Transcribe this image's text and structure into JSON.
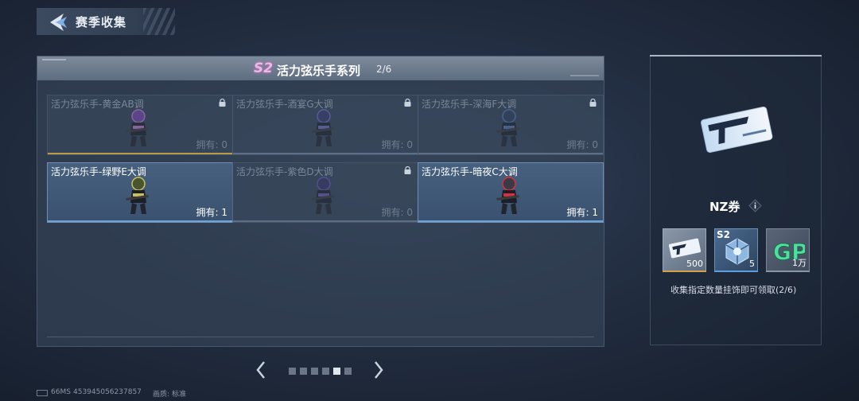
{
  "header": {
    "title": "赛季收集"
  },
  "panel": {
    "badge": "S2",
    "title": "活力弦乐手系列",
    "progress": "2/6",
    "cards": [
      {
        "name": "活力弦乐手-黄金AB调",
        "owned_text": "拥有: 0",
        "locked": true,
        "bar_color": "#b89a4a",
        "char_color": "#7a48b0",
        "accent": "#cc7fd8"
      },
      {
        "name": "活力弦乐手-酒宴G大调",
        "owned_text": "拥有: 0",
        "locked": true,
        "bar_color": "#5e6f85",
        "char_color": "#3d3a6e",
        "accent": "#6f74c8"
      },
      {
        "name": "活力弦乐手-深海F大调",
        "owned_text": "拥有: 0",
        "locked": true,
        "bar_color": "#5e6f85",
        "char_color": "#2d3d5e",
        "accent": "#5a7bb8"
      },
      {
        "name": "活力弦乐手-绿野E大调",
        "owned_text": "拥有: 1",
        "locked": false,
        "bar_color": "#6fa3d6",
        "char_color": "#4a5530",
        "accent": "#c8c060"
      },
      {
        "name": "活力弦乐手-紫色D大调",
        "owned_text": "拥有: 0",
        "locked": true,
        "bar_color": "#5e6f85",
        "char_color": "#3a3468",
        "accent": "#6a5ab8"
      },
      {
        "name": "活力弦乐手-暗夜C大调",
        "owned_text": "拥有: 1",
        "locked": false,
        "bar_color": "#6fa3d6",
        "char_color": "#3a3a44",
        "accent": "#d83040"
      }
    ]
  },
  "pagination": {
    "pages": 6,
    "current": 5
  },
  "reward": {
    "name": "NZ券",
    "items": [
      {
        "label": "",
        "count": "500",
        "icon": "nz-ticket-icon",
        "bar": "#d4a04a"
      },
      {
        "label": "S2",
        "count": "5",
        "icon": "s2-box-icon",
        "bar": "#5aa0e0"
      },
      {
        "label": "",
        "count": "1万",
        "icon": "gp-icon",
        "bar": "#8a96a6"
      }
    ],
    "description": "收集指定数量挂饰即可领取(2/6)"
  },
  "footer": {
    "ping": "66MS",
    "uid": "453945056237857",
    "quality_label": "画质:",
    "quality_value": "标准"
  }
}
